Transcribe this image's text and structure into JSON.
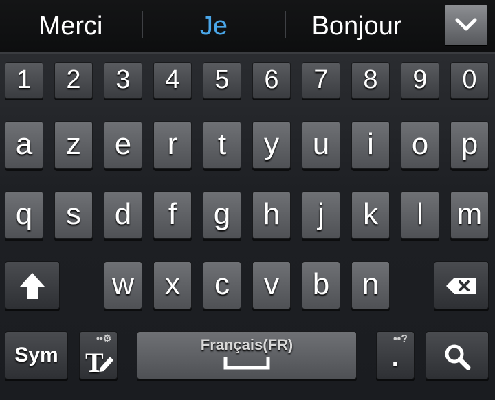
{
  "suggestions": {
    "items": [
      {
        "label": "Merci"
      },
      {
        "label": "Je"
      },
      {
        "label": "Bonjour"
      }
    ],
    "collapse_icon": "chevron-down-icon"
  },
  "keyboard": {
    "number_row": [
      "1",
      "2",
      "3",
      "4",
      "5",
      "6",
      "7",
      "8",
      "9",
      "0"
    ],
    "row1": [
      "a",
      "z",
      "e",
      "r",
      "t",
      "y",
      "u",
      "i",
      "o",
      "p"
    ],
    "row2": [
      "q",
      "s",
      "d",
      "f",
      "g",
      "h",
      "j",
      "k",
      "l",
      "m"
    ],
    "row3": [
      "w",
      "x",
      "c",
      "v",
      "b",
      "n"
    ],
    "shift_icon": "shift-arrow-icon",
    "backspace_icon": "backspace-icon",
    "sym_label": "Sym",
    "text_tool_icon": "text-edit-icon",
    "space_language": "Français(FR)",
    "period_label": ".",
    "period_hint": "?",
    "search_icon": "search-icon",
    "colors": {
      "active_suggestion": "#4aa6e8",
      "key_face": "#5f6165",
      "background": "#1c1e22"
    }
  }
}
